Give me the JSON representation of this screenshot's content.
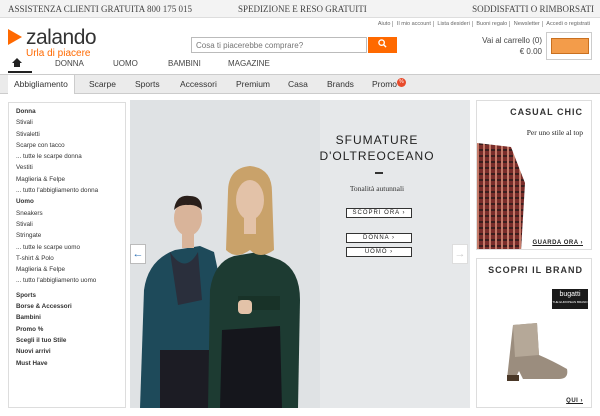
{
  "topbar": {
    "left": "ASSISTENZA CLIENTI GRATUITA 800 175 015",
    "center": "SPEDIZIONE E RESO GRATUITI",
    "right": "SODDISFATTI O RIMBORSATI"
  },
  "logo": {
    "text": "zalando",
    "tagline": "Urla di piacere"
  },
  "util_links": [
    "Aiuto",
    "Il mio account",
    "Lista desideri",
    "Buoni regalo",
    "Newsletter",
    "Accedi o registrati"
  ],
  "search": {
    "placeholder": "Cosa ti piacerebbe comprare?",
    "icon": "search-icon"
  },
  "cart": {
    "label": "Vai al carrello (0)",
    "total": "€ 0.00"
  },
  "gender_nav": [
    "DONNA",
    "UOMO",
    "BAMBINI",
    "MAGAZINE"
  ],
  "category_nav": [
    "Abbigliamento",
    "Scarpe",
    "Sports",
    "Accessori",
    "Premium",
    "Casa",
    "Brands",
    "Promo"
  ],
  "promo_badge": "%",
  "sidebar": [
    {
      "text": "Donna",
      "bold": true
    },
    {
      "text": "Stivali"
    },
    {
      "text": "Stivaletti"
    },
    {
      "text": "Scarpe con tacco"
    },
    {
      "text": "... tutte le scarpe donna"
    },
    {
      "text": "Vestiti"
    },
    {
      "text": "Maglieria & Felpe"
    },
    {
      "text": "... tutto l'abbigliamento donna"
    },
    {
      "text": "Uomo",
      "bold": true
    },
    {
      "text": "Sneakers"
    },
    {
      "text": "Stivali"
    },
    {
      "text": "Stringate"
    },
    {
      "text": "... tutte le scarpe uomo"
    },
    {
      "text": "T-shirt & Polo"
    },
    {
      "text": "Maglieria & Felpe"
    },
    {
      "text": "... tutto l'abbigliamento uomo"
    },
    {
      "text": "Sports",
      "bold": true,
      "gap": true
    },
    {
      "text": "Borse & Accessori",
      "bold": true
    },
    {
      "text": "Bambini",
      "bold": true
    },
    {
      "text": "Promo %",
      "bold": true
    },
    {
      "text": "Scegli il tuo Stile",
      "bold": true
    },
    {
      "text": "Nuovi arrivi",
      "bold": true
    },
    {
      "text": "Must Have",
      "bold": true
    }
  ],
  "hero": {
    "title_line1": "SFUMATURE",
    "title_line2": "D'OLTREOCEANO",
    "subtitle": "Tonalità autunnali",
    "cta": "SCOPRI ORA ›",
    "btn_donna": "DONNA ›",
    "btn_uomo": "UOMO ›",
    "arrow_left": "←",
    "arrow_right": "→"
  },
  "casual": {
    "title": "CASUAL CHIC",
    "subtitle": "Per uno stile al top",
    "link": "GUARDA ORA ›"
  },
  "brand": {
    "title": "SCOPRI IL BRAND",
    "logo": "bugatti",
    "logo_sub": "THE EUROPEAN BRAND",
    "link": "QUI ›"
  },
  "colors": {
    "accent": "#ff6900",
    "nav_bg": "#ebebeb"
  }
}
